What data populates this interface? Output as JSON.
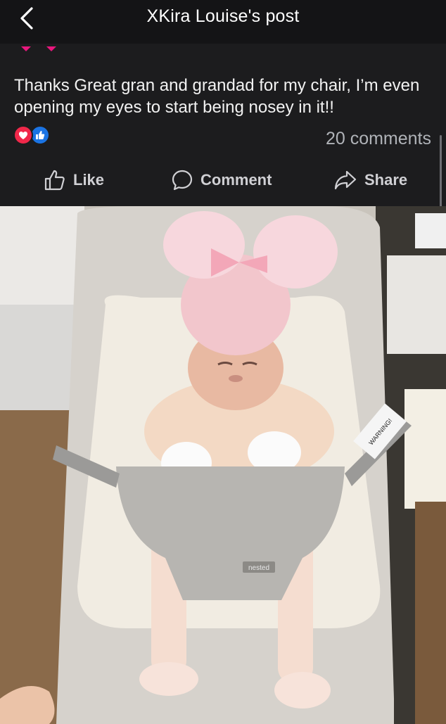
{
  "header": {
    "title": "XKira Louise's post",
    "back_icon": "chevron-left-icon"
  },
  "post": {
    "text": "Thanks Great gran and grandad for my chair, I’m even opening my eyes to start being nosey in it!!",
    "reactions": [
      "love-icon",
      "like-icon"
    ],
    "comments_label": "20 comments"
  },
  "actions": {
    "like_label": "Like",
    "comment_label": "Comment",
    "share_label": "Share"
  },
  "photo": {
    "brand_label": "nested",
    "warning_label": "WARNING!"
  },
  "colors": {
    "background": "#1c1c1e",
    "header": "#141416",
    "accent_pink": "#e8177d",
    "love": "#f0284a",
    "like": "#1b74e4",
    "muted_text": "#b0b3b8"
  }
}
